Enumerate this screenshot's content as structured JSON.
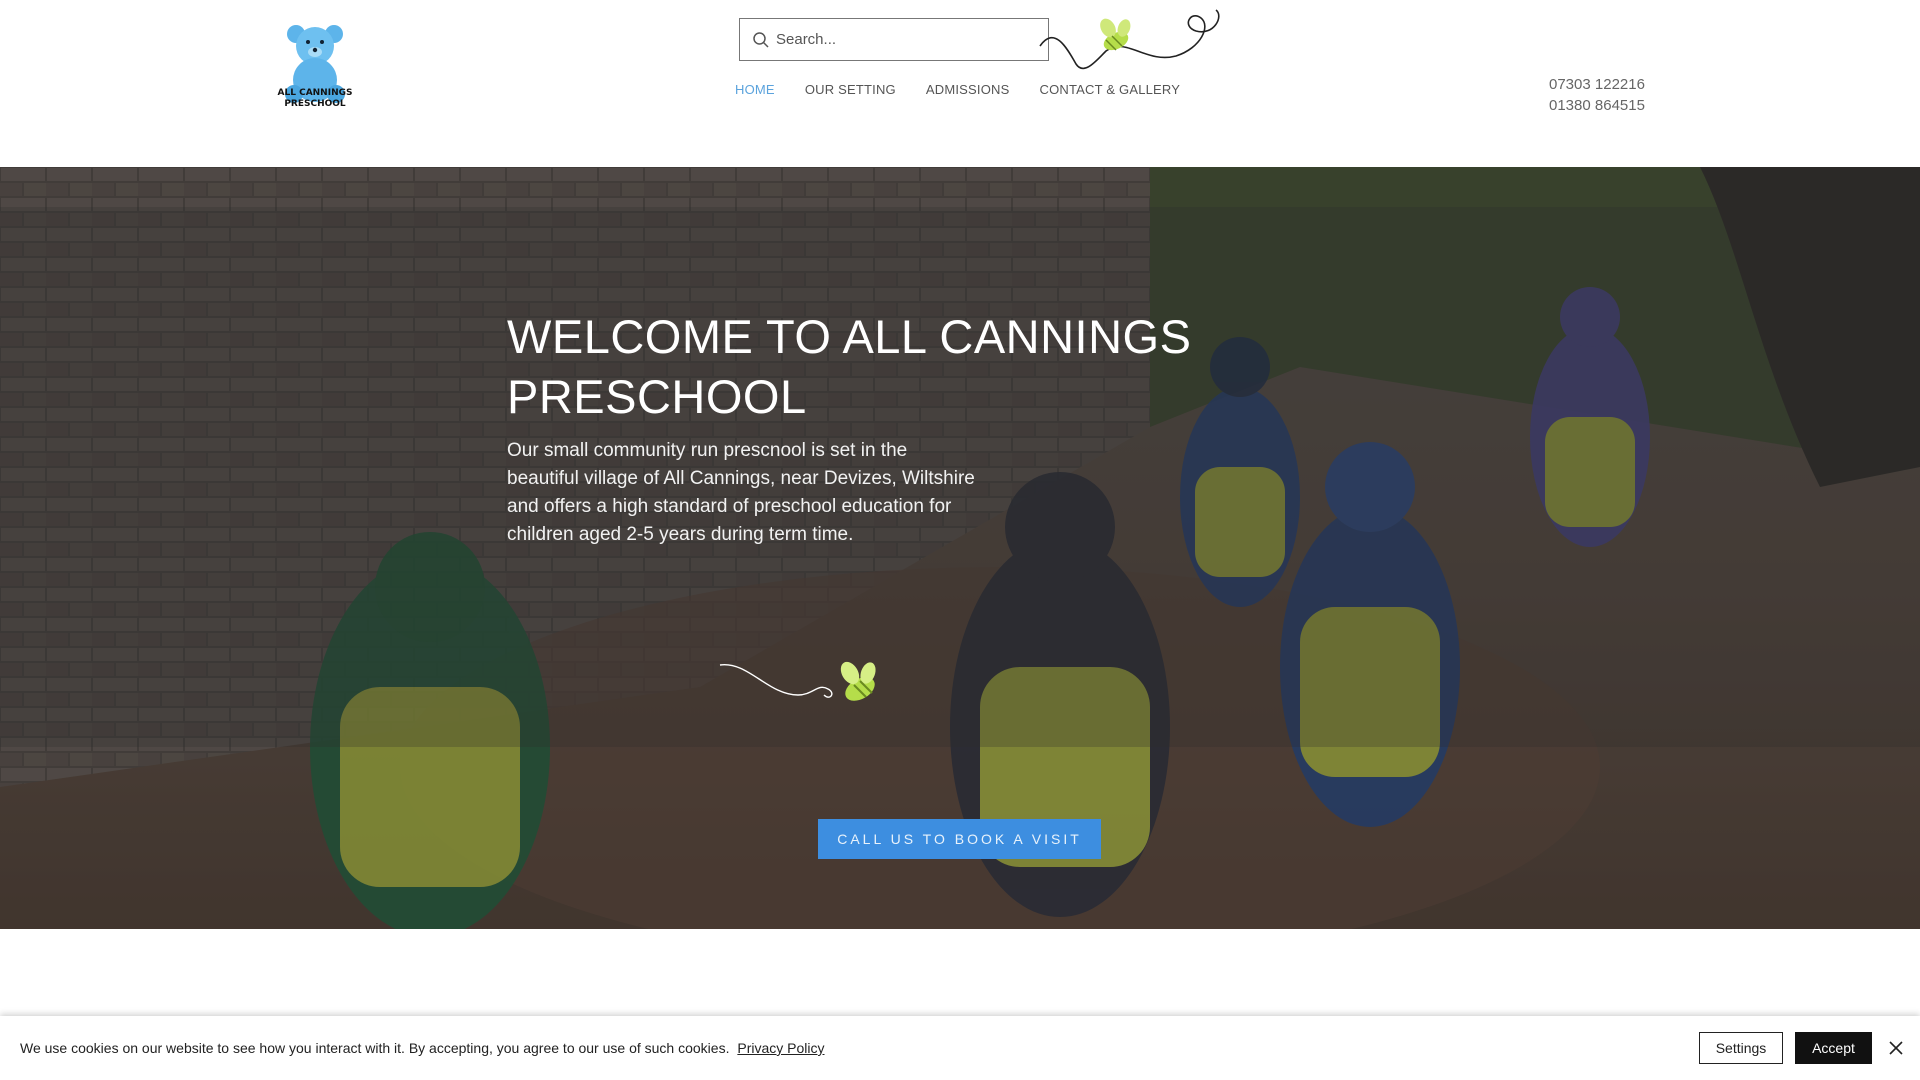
{
  "header": {
    "logo_text_line1": "ALL CANNINGS",
    "logo_text_line2": "PRESCHOOL",
    "search_placeholder": "Search...",
    "nav": [
      {
        "label": "HOME",
        "active": true
      },
      {
        "label": "OUR SETTING",
        "active": false
      },
      {
        "label": "ADMISSIONS",
        "active": false
      },
      {
        "label": "CONTACT & GALLERY",
        "active": false
      }
    ],
    "phones": [
      "07303 122216",
      "01380 864515"
    ]
  },
  "hero": {
    "title": "WELCOME TO ALL CANNINGS PRESCHOOL",
    "text": "Our small community run prescnool is set in the beautiful village of All Cannings, near Devizes, Wiltshire and offers a high standard of preschool education for children aged 2-5 years during term time.",
    "cta_label": "CALL US TO BOOK A VISIT"
  },
  "cookie_banner": {
    "message": "We use cookies on our website to see how you interact with it. By accepting, you agree to our use of such cookies.",
    "privacy_link": "Privacy Policy",
    "settings_label": "Settings",
    "accept_label": "Accept"
  },
  "colors": {
    "accent": "#5ba3dd",
    "cta": "#3d8ee0",
    "bee": "#b5dd4a"
  },
  "icons": [
    "teddy-bear-logo-icon",
    "search-icon",
    "bee-icon",
    "close-icon"
  ]
}
